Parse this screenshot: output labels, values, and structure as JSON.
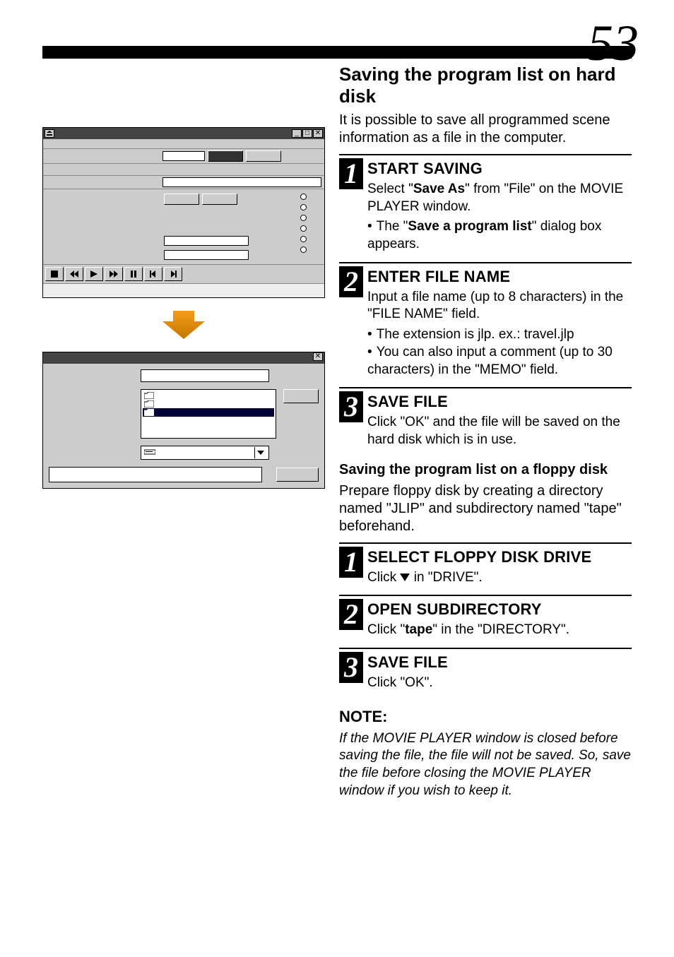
{
  "page_number": "53",
  "main_heading": "Saving the program list on hard disk",
  "intro": "It is possible to save all programmed scene information as a file in the computer.",
  "steps_hd": [
    {
      "num": "1",
      "title": "START SAVING",
      "body": "Select \"Save As\" from \"File\" on the MOVIE PLAYER window.",
      "body_bold": "Save As",
      "bullets": [
        "The \"Save a program list\" dialog box appears."
      ],
      "bullet_bold": "Save a program list"
    },
    {
      "num": "2",
      "title": "ENTER FILE NAME",
      "body": "Input a file name (up to 8 characters) in the \"FILE NAME\" field.",
      "bullets": [
        "The extension is jlp.  ex.: travel.jlp",
        "You can also input a comment (up to 30 characters) in the  \"MEMO\" field."
      ]
    },
    {
      "num": "3",
      "title": "SAVE FILE",
      "body": "Click \"OK\" and the file will be saved on the hard disk which is in use."
    }
  ],
  "floppy_heading": "Saving the program list on a floppy disk",
  "floppy_intro": "Prepare floppy disk by creating a directory named \"JLIP\" and subdirectory named \"tape\" beforehand.",
  "steps_fd": [
    {
      "num": "1",
      "title": "SELECT FLOPPY DISK DRIVE",
      "body": "Click ▼ in \"DRIVE\"."
    },
    {
      "num": "2",
      "title": "OPEN SUBDIRECTORY",
      "body": "Click \"tape\" in the \"DIRECTORY\".",
      "body_bold": "tape"
    },
    {
      "num": "3",
      "title": "SAVE FILE",
      "body": "Click \"OK\"."
    }
  ],
  "note_heading": "NOTE:",
  "note_body": "If the MOVIE PLAYER window is closed before saving the file, the file will not be saved. So, save the file before closing the MOVIE PLAYER window if you wish to keep it.",
  "dialog": {
    "dir_items": [
      "",
      "",
      ""
    ]
  }
}
